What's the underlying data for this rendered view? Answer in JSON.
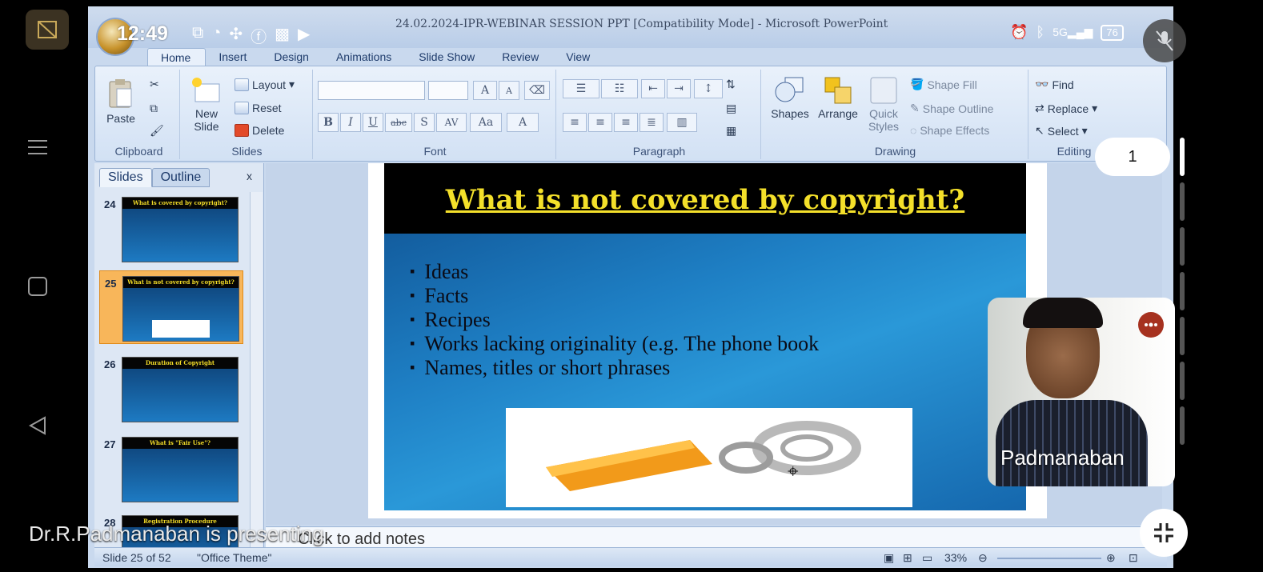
{
  "status_bar": {
    "time": "12:49",
    "battery": "76",
    "network": "5G"
  },
  "window": {
    "title": "24.02.2024-IPR-WEBINAR SESSION PPT [Compatibility Mode] - Microsoft PowerPoint"
  },
  "menu_tabs": [
    {
      "label": "Home",
      "active": true
    },
    {
      "label": "Insert"
    },
    {
      "label": "Design"
    },
    {
      "label": "Animations"
    },
    {
      "label": "Slide Show"
    },
    {
      "label": "Review"
    },
    {
      "label": "View"
    }
  ],
  "ribbon": {
    "clipboard": {
      "label": "Clipboard",
      "paste": "Paste"
    },
    "slides": {
      "label": "Slides",
      "new_slide_1": "New",
      "new_slide_2": "Slide",
      "layout": "Layout",
      "reset": "Reset",
      "delete": "Delete"
    },
    "font": {
      "label": "Font",
      "bold": "B",
      "italic": "I",
      "underline": "U",
      "strike": "abc",
      "shadow": "S",
      "spacing": "AV",
      "case": "Aa",
      "color": "A",
      "grow": "A",
      "shrink": "A"
    },
    "paragraph": {
      "label": "Paragraph"
    },
    "drawing": {
      "label": "Drawing",
      "shapes": "Shapes",
      "arrange": "Arrange",
      "quick_styles_1": "Quick",
      "quick_styles_2": "Styles",
      "shape_fill": "Shape Fill",
      "shape_outline": "Shape Outline",
      "shape_effects": "Shape Effects"
    },
    "editing": {
      "label": "Editing",
      "find": "Find",
      "replace": "Replace",
      "select": "Select"
    }
  },
  "slides_panel": {
    "tabs": [
      "Slides",
      "Outline"
    ],
    "close": "x",
    "thumbnails": [
      {
        "number": "24",
        "title": "What is covered by copyright?"
      },
      {
        "number": "25",
        "title": "What is not covered by copyright?",
        "selected": true
      },
      {
        "number": "26",
        "title": "Duration of Copyright"
      },
      {
        "number": "27",
        "title": "What is \"Fair Use\"?"
      },
      {
        "number": "28",
        "title": "Registration Procedure"
      }
    ]
  },
  "slide": {
    "title": "What is not covered by copyright?",
    "bullets": [
      "Ideas",
      "Facts",
      "Recipes",
      "Works lacking originality (e.g. The phone book",
      "Names, titles or short phrases"
    ]
  },
  "notes": {
    "placeholder": "Click to add notes"
  },
  "status": {
    "slide_counter": "Slide 25 of 52",
    "theme": "\"Office Theme\"",
    "zoom": "33%"
  },
  "meeting": {
    "participant_count": "1",
    "speaker_name": "Padmanaban",
    "presenting_text": "Dr.R.Padmanaban is presenting"
  },
  "colors": {
    "slide_title": "#f4e02a",
    "slide_bg": "#1e7fc4",
    "selected_thumb": "#f8b65a"
  }
}
